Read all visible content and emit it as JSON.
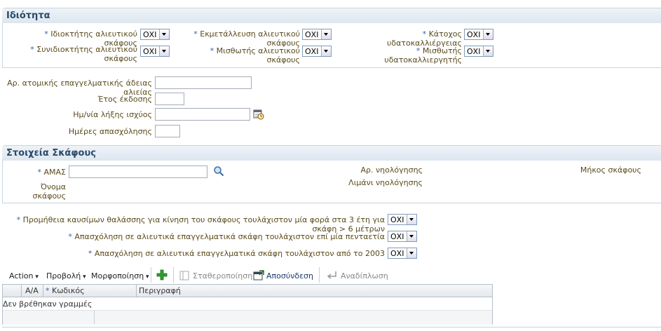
{
  "ownership": {
    "title": "Ιδιότητα",
    "fields": [
      {
        "label": "Ιδιοκτήτης αλιευτικού σκάφους",
        "value": "ΟΧΙ"
      },
      {
        "label": "Εκμετάλλευση αλιευτικού σκάφους",
        "value": "ΟΧΙ"
      },
      {
        "label": "Κάτοχος υδατοκαλλιέργειας",
        "value": "ΟΧΙ"
      },
      {
        "label_line1": "Συνιδιοκτήτης αλιευτικού",
        "label_line2": "σκάφους",
        "value": "ΟΧΙ"
      },
      {
        "label": "Μισθωτής αλιευτικού σκάφους",
        "value": "ΟΧΙ"
      },
      {
        "label": "Μισθωτής υδατοκαλλιεργητής",
        "value": "ΟΧΙ"
      }
    ]
  },
  "license": {
    "number_label": "Αρ. ατομικής επαγγελματικής άδειας αλιείας",
    "number_value": "",
    "year_label": "Έτος έκδοσης",
    "year_value": "",
    "expiry_label": "Ημ/νία λήξης ισχύος",
    "expiry_value": "",
    "days_label": "Ημέρες απασχόλησης",
    "days_value": ""
  },
  "vessel": {
    "title": "Στοιχεία Σκάφους",
    "amas_label": "ΑΜΑΣ",
    "amas_value": "",
    "name_label_line1": "Όνομα",
    "name_label_line2": "σκάφους",
    "registry_no_label": "Αρ. νηολόγησης",
    "registry_port_label": "Λιμάνι νηολόγησης",
    "length_label": "Μήκος σκάφους"
  },
  "questions": [
    {
      "label": "Προμήθεια καυσίμων θαλάσσης για κίνηση του σκάφους τουλάχιστον μία φορά στα 3 έτη για σκάφη > 6 μέτρων",
      "value": "ΟΧΙ"
    },
    {
      "label": "Απασχόληση σε αλιευτικά επαγγελματικά σκάφη τουλάχιστον επί μία πενταετία",
      "value": "ΟΧΙ"
    },
    {
      "label": "Απασχόληση σε αλιευτικά επαγγελματικά σκάφη τουλάχιστον από το 2003",
      "value": "ΟΧΙ"
    }
  ],
  "toolbar": {
    "action": "Action",
    "view": "Προβολή",
    "format": "Μορφοποίηση",
    "freeze": "Σταθεροποίηση",
    "detach": "Αποσύνδεση",
    "wrap": "Αναδίπλωση"
  },
  "table": {
    "columns": [
      "Α/Α",
      "Κωδικός",
      "Περιγραφή"
    ],
    "empty_text": "Δεν βρέθηκαν γραμμές"
  },
  "colors": {
    "accent": "#2a4a6a",
    "label": "#5a4a1a",
    "required": "#3a5fa0",
    "add_icon": "#2e9e2e"
  }
}
